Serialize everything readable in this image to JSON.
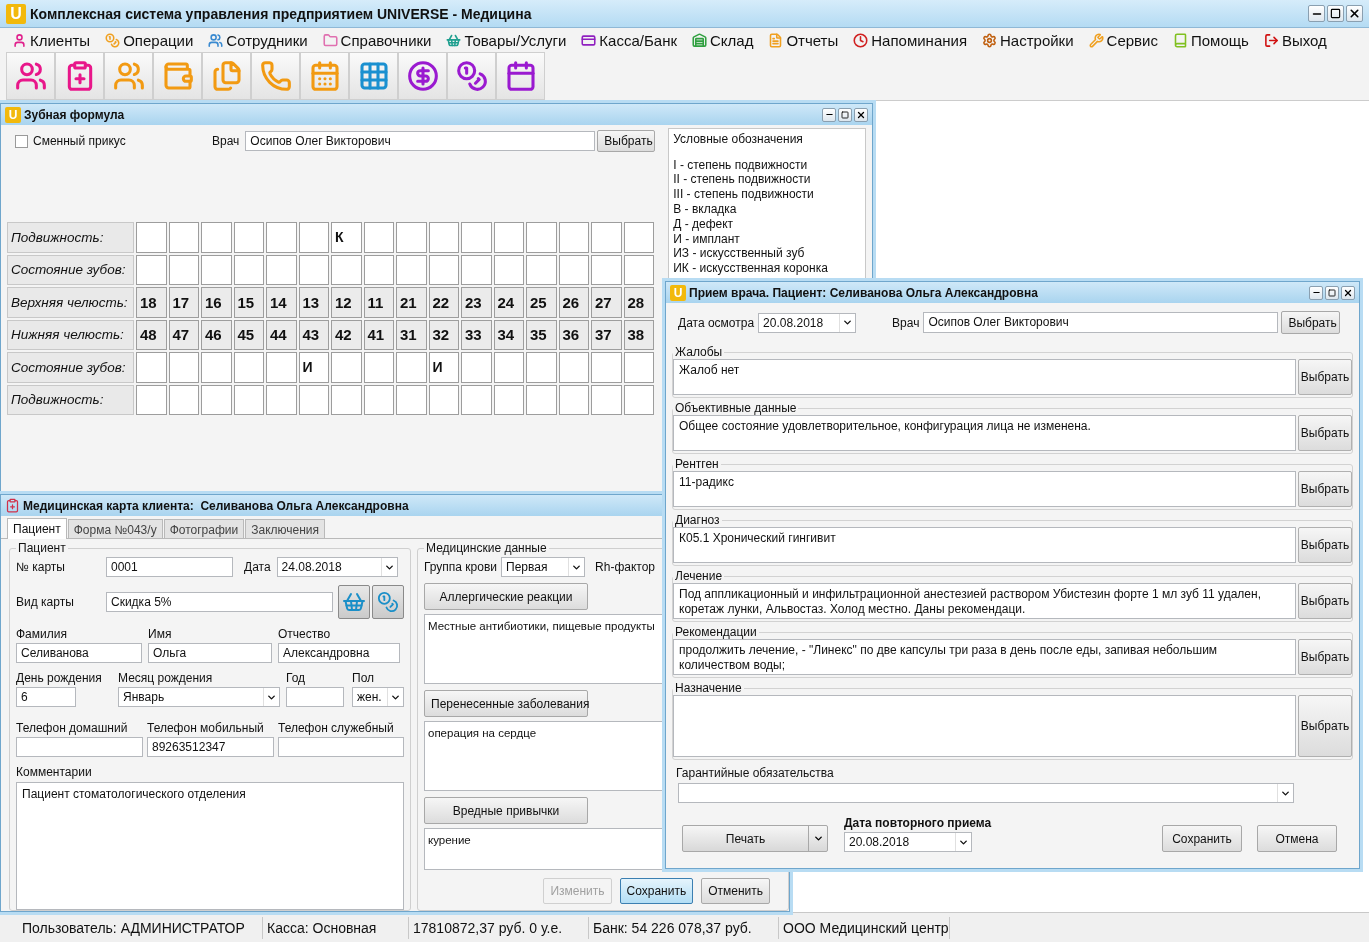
{
  "app": {
    "logo": "U",
    "title": "Комплексная система управления предприятием UNIVERSE - Медицина"
  },
  "menu": [
    {
      "label": "Клиенты",
      "color": "#e0208c"
    },
    {
      "label": "Операции",
      "color": "#f0a020"
    },
    {
      "label": "Сотрудники",
      "color": "#3a8ad0"
    },
    {
      "label": "Справочники",
      "color": "#e070b0"
    },
    {
      "label": "Товары/Услуги",
      "color": "#20a090"
    },
    {
      "label": "Касса/Банк",
      "color": "#9020c0"
    },
    {
      "label": "Склад",
      "color": "#30a040"
    },
    {
      "label": "Отчеты",
      "color": "#f0a020"
    },
    {
      "label": "Напоминания",
      "color": "#d02020"
    },
    {
      "label": "Настройки",
      "color": "#c06010"
    },
    {
      "label": "Сервис",
      "color": "#f0a020"
    },
    {
      "label": "Помощь",
      "color": "#80c020"
    },
    {
      "label": "Выход",
      "color": "#d01010"
    }
  ],
  "toolbar": [
    {
      "color": "#e8178a"
    },
    {
      "color": "#e8178a"
    },
    {
      "color": "#f29a12"
    },
    {
      "color": "#f29a12"
    },
    {
      "color": "#f29a12"
    },
    {
      "color": "#f29a12"
    },
    {
      "color": "#f29a12"
    },
    {
      "color": "#1a90d0"
    },
    {
      "color": "#9a1ad0"
    },
    {
      "color": "#9a1ad0"
    },
    {
      "color": "#9a1ad0"
    }
  ],
  "dental": {
    "logo": "U",
    "title": "Зубная формула",
    "mixed_bite": {
      "label": "Сменный прикус",
      "checked": false
    },
    "doctor_label": "Врач",
    "doctor": "Осипов Олег Викторович",
    "choose": "Выбрать",
    "legend_title": "Условные обозначения",
    "legend": [
      "I - степень подвижности",
      "II - степень подвижности",
      "III - степень подвижности",
      "В - вкладка",
      "Д - дефект",
      "И - имплант",
      "ИЗ - искусственный зуб",
      "ИК - искусственная коронка"
    ],
    "rows": [
      {
        "label": "Подвижность:",
        "kind": "mark",
        "cells": [
          null,
          null,
          null,
          null,
          null,
          null,
          "К",
          null,
          null,
          null,
          null,
          null,
          null,
          null,
          null,
          null
        ]
      },
      {
        "label": "Состояние зубов:",
        "kind": "mark",
        "cells": [
          null,
          null,
          null,
          null,
          null,
          null,
          null,
          null,
          null,
          null,
          null,
          null,
          null,
          null,
          null,
          null
        ]
      },
      {
        "label": "Верхняя челюсть:",
        "kind": "teeth",
        "cells": [
          "18",
          "17",
          "16",
          "15",
          "14",
          "13",
          "12",
          "11",
          "21",
          "22",
          "23",
          "24",
          "25",
          "26",
          "27",
          "28"
        ]
      },
      {
        "label": "Нижняя челюсть:",
        "kind": "teeth",
        "cells": [
          "48",
          "47",
          "46",
          "45",
          "44",
          "43",
          "42",
          "41",
          "31",
          "32",
          "33",
          "34",
          "35",
          "36",
          "37",
          "38"
        ]
      },
      {
        "label": "Состояние зубов:",
        "kind": "mark",
        "cells": [
          null,
          null,
          null,
          null,
          null,
          "И",
          null,
          null,
          null,
          "И",
          null,
          null,
          null,
          null,
          null,
          null
        ]
      },
      {
        "label": "Подвижность:",
        "kind": "mark",
        "cells": [
          null,
          null,
          null,
          null,
          null,
          null,
          null,
          null,
          null,
          null,
          null,
          null,
          null,
          null,
          null,
          null
        ]
      }
    ]
  },
  "card": {
    "title": "Медицинская карта клиента:  Селиванова Ольга Александровна",
    "tabs": [
      {
        "label": "Пациент",
        "selected": true
      },
      {
        "label": "Форма №043/у",
        "selected": false
      },
      {
        "label": "Фотографии",
        "selected": false
      },
      {
        "label": "Заключения",
        "selected": false
      }
    ],
    "patient_group": "Пациент",
    "card_no_label": "№ карты",
    "card_no": "0001",
    "date_label": "Дата",
    "date": "24.08.2018",
    "card_type_label": "Вид карты",
    "card_type": "Скидка 5%",
    "surname_label": "Фамилия",
    "surname": "Селиванова",
    "name_label": "Имя",
    "name": "Ольга",
    "patronymic_label": "Отчество",
    "patronymic": "Александровна",
    "birth_day_label": "День рождения",
    "birth_day": "6",
    "birth_month_label": "Месяц рождения",
    "birth_month": "Январь",
    "year_label": "Год",
    "sex_label": "Пол",
    "sex": "жен.",
    "phone_home_label": "Телефон домашний",
    "phone_mobile_label": "Телефон мобильный",
    "phone_mobile": "89263512347",
    "phone_work_label": "Телефон служебный",
    "comments_label": "Комментарии",
    "comments": "Пациент стоматологического отделения",
    "medical_group": "Медицинские данные",
    "blood_label": "Группа крови",
    "blood": "Первая",
    "rh_label": "Rh-фактор",
    "sections": [
      {
        "button": "Аллергические реакции",
        "text": "Местные антибиотики, пищевые продукты"
      },
      {
        "button": "Перенесенные заболевания",
        "text": "операция на сердце"
      },
      {
        "button": "Вредные привычки",
        "text": "курение"
      }
    ],
    "buttons": [
      {
        "label": "Изменить",
        "disabled": true,
        "focused": false
      },
      {
        "label": "Сохранить",
        "disabled": false,
        "focused": true
      },
      {
        "label": "Отменить",
        "disabled": false,
        "focused": false
      }
    ]
  },
  "visit": {
    "logo": "U",
    "title": "Прием врача. Пациент: Селиванова Ольга Александровна",
    "date_label": "Дата осмотра",
    "date": "20.08.2018",
    "doctor_label": "Врач",
    "doctor": "Осипов Олег Викторович",
    "choose": "Выбрать",
    "sections": [
      {
        "label": "Жалобы",
        "text": "Жалоб нет",
        "button": "Выбрать"
      },
      {
        "label": "Объективные данные",
        "text": "Общее состояние удовлетворительное, конфигурация лица не изменена.",
        "button": "Выбрать"
      },
      {
        "label": "Рентген",
        "text": "11-радикс",
        "button": "Выбрать"
      },
      {
        "label": "Диагноз",
        "text": "К05.1 Хронический гингивит",
        "button": "Выбрать"
      },
      {
        "label": "Лечение",
        "text": "Под аппликационный и инфильтрационной анестезией раствором Убистезин форте 1 мл зуб 11 удален, коретаж лунки, Альвостаз. Холод местно. Даны рекомендаци.",
        "button": "Выбрать"
      },
      {
        "label": "Рекомендации",
        "text": "продолжить лечение,  - \"Линекс\" по две капсулы три раза в день после еды, запивая небольшим количеством воды;",
        "button": "Выбрать"
      },
      {
        "label": "Назначение",
        "button": "Выбрать"
      }
    ],
    "warranty_label": "Гарантийные обязательства",
    "print": "Печать",
    "next_date_label": "Дата повторного приема",
    "next_date": "20.08.2018",
    "save": "Сохранить",
    "cancel": "Отмена"
  },
  "status_bar": [
    "Пользователь: АДМИНИСТРАТОР",
    "Касса: Основная",
    "17810872,37 руб. 0 у.е.",
    "Банк: 54 226 078,37 руб.",
    "ООО Медицинский центр"
  ]
}
